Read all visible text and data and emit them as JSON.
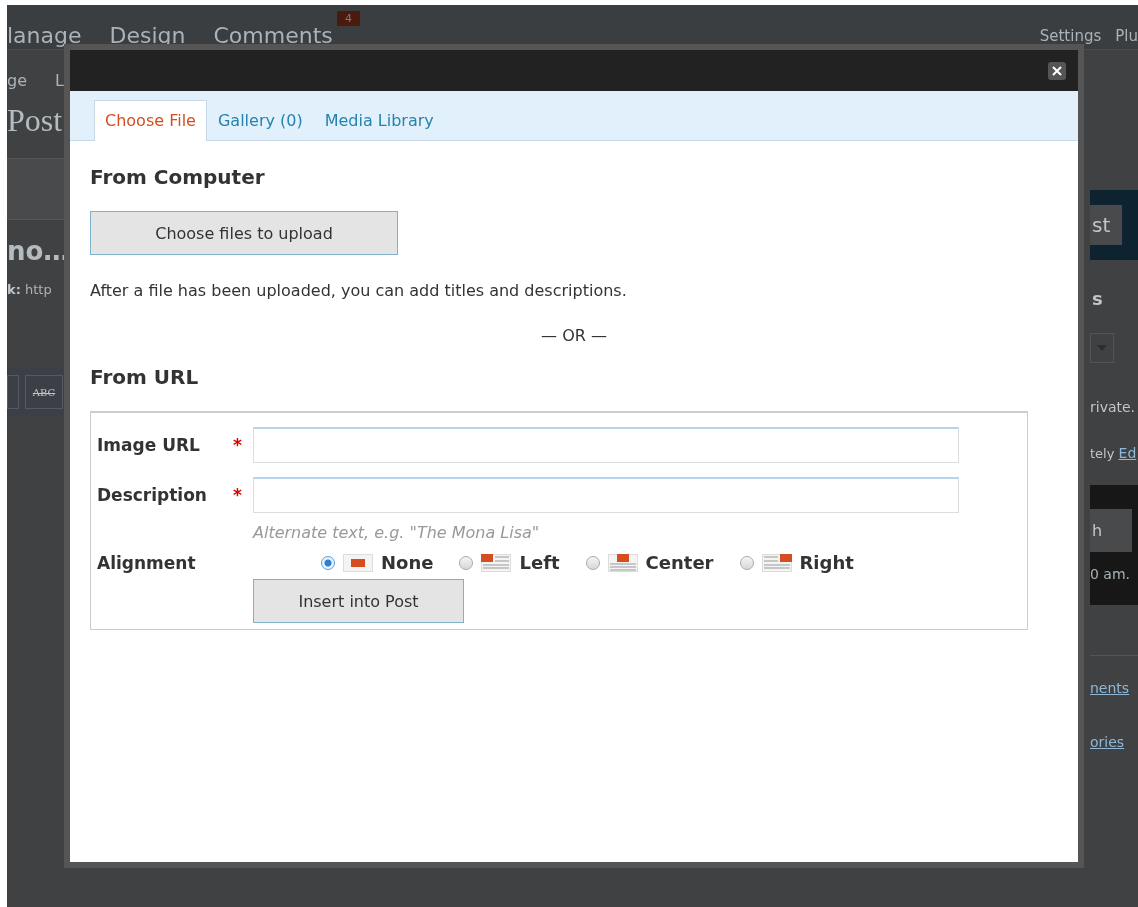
{
  "background": {
    "nav": [
      "lanage",
      "Design",
      "Comments"
    ],
    "comment_count": "4",
    "right_nav": [
      "Settings",
      "Plu"
    ],
    "subnav": [
      "ge",
      "L"
    ],
    "page_title": "Post",
    "post_title": "no…",
    "permalink_label": "k:",
    "permalink_value": "http",
    "toolbar_button": "ABC",
    "publish_button": "st",
    "box_heading": "s",
    "visibility_text": "rivate.",
    "schedule_text": "tely",
    "edit_link": "Ed",
    "publish_action": "h",
    "time_text": "0 am.",
    "links": [
      "nents",
      "ories"
    ]
  },
  "modal": {
    "tabs": [
      {
        "label": "Choose File",
        "selected": true
      },
      {
        "label": "Gallery (0)",
        "selected": false
      },
      {
        "label": "Media Library",
        "selected": false
      }
    ],
    "from_computer": {
      "heading": "From Computer",
      "button": "Choose files to upload",
      "note": "After a file has been uploaded, you can add titles and descriptions."
    },
    "separator": "— OR —",
    "from_url": {
      "heading": "From URL",
      "fields": [
        {
          "label": "Image URL",
          "required_mark": "*"
        },
        {
          "label": "Description",
          "required_mark": "*"
        }
      ],
      "hint": "Alternate text, e.g. \"The Mona Lisa\"",
      "alignment_label": "Alignment",
      "alignment_options": [
        {
          "label": "None",
          "kind": "none",
          "selected": true
        },
        {
          "label": "Left",
          "kind": "left",
          "selected": false
        },
        {
          "label": "Center",
          "kind": "center",
          "selected": false
        },
        {
          "label": "Right",
          "kind": "right",
          "selected": false
        }
      ],
      "button": "Insert into Post"
    }
  }
}
